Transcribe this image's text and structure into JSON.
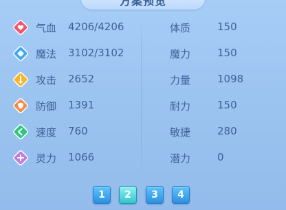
{
  "title": "方案预览",
  "rows": [
    {
      "icon": "heart-icon",
      "icon_color": "#f2566f",
      "left_label": "气血",
      "left_value": "4206/4206",
      "right_label": "体质",
      "right_value": "150"
    },
    {
      "icon": "mana-diamond-icon",
      "icon_color": "#3ea9f2",
      "left_label": "魔法",
      "left_value": "3102/3102",
      "right_label": "魔力",
      "right_value": "150"
    },
    {
      "icon": "sword-icon",
      "icon_color": "#f5b52a",
      "left_label": "攻击",
      "left_value": "2652",
      "right_label": "力量",
      "right_value": "1098"
    },
    {
      "icon": "shield-icon",
      "icon_color": "#f08c4a",
      "left_label": "防御",
      "left_value": "1391",
      "right_label": "耐力",
      "right_value": "150"
    },
    {
      "icon": "speed-arrow-icon",
      "icon_color": "#2fc77e",
      "left_label": "速度",
      "left_value": "760",
      "right_label": "敏捷",
      "right_value": "280"
    },
    {
      "icon": "spirit-cross-icon",
      "icon_color": "#c07be0",
      "left_label": "灵力",
      "left_value": "1066",
      "right_label": "潜力",
      "right_value": "0"
    }
  ],
  "pages": [
    "1",
    "2",
    "3",
    "4"
  ],
  "active_page": "2"
}
